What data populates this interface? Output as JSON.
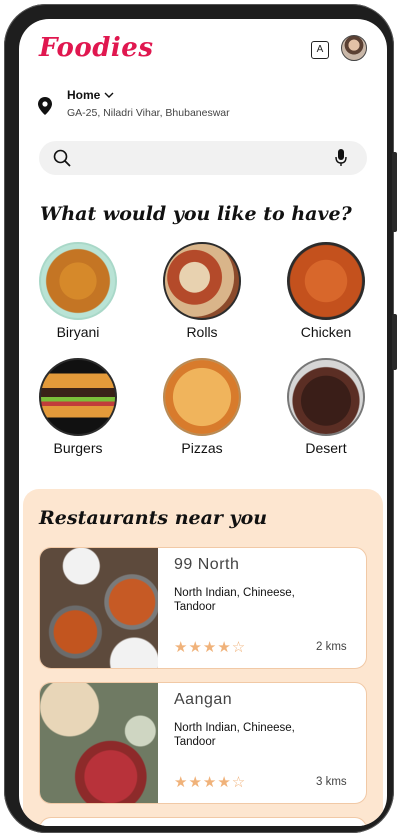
{
  "app": {
    "logo": "Foodies"
  },
  "header": {
    "translate_icon": "translate-icon",
    "avatar": "user-avatar"
  },
  "location": {
    "label": "Home",
    "address": "GA-25, Niladri Vihar, Bhubaneswar"
  },
  "search": {
    "placeholder": ""
  },
  "categories_title": "What would you like to have?",
  "categories": [
    {
      "label": "Biryani"
    },
    {
      "label": "Rolls"
    },
    {
      "label": "Chicken"
    },
    {
      "label": "Burgers"
    },
    {
      "label": "Pizzas"
    },
    {
      "label": "Desert"
    }
  ],
  "restaurants_title": "Restaurants near you",
  "restaurants": [
    {
      "name": "99 North",
      "cuisine": "North Indian, Chineese, Tandoor",
      "rating": 4,
      "stars": "★★★★☆",
      "distance": "2 kms"
    },
    {
      "name": "Aangan",
      "cuisine": "North Indian, Chineese, Tandoor",
      "rating": 4,
      "stars": "★★★★☆",
      "distance": "3 kms"
    }
  ],
  "colors": {
    "brand": "#e0174f",
    "panel": "#fde6d0",
    "star": "#f0b27a"
  }
}
